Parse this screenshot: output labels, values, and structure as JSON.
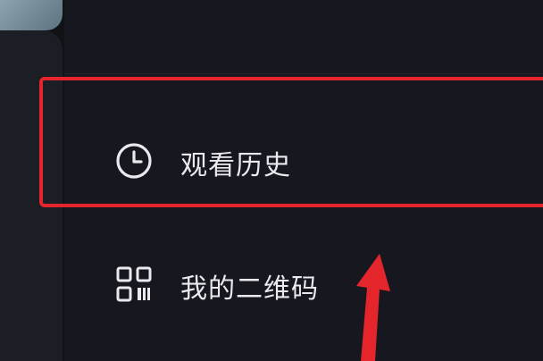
{
  "background": {
    "behind_thumbnail": "blurred-photo-thumbnail"
  },
  "drawer": {
    "items": [
      {
        "id": "partial-top",
        "label": "",
        "icon": "partially-visible-icon"
      },
      {
        "id": "history",
        "label": "观看历史",
        "icon": "clock-icon"
      },
      {
        "id": "qrcode",
        "label": "我的二维码",
        "icon": "qrcode-icon"
      }
    ]
  },
  "annotation": {
    "highlight_color": "#e4252c",
    "highlighted_item": "history",
    "arrow_color": "#e4252c"
  },
  "colors": {
    "drawer_bg": "#17181f",
    "text": "#e9e9ee"
  }
}
